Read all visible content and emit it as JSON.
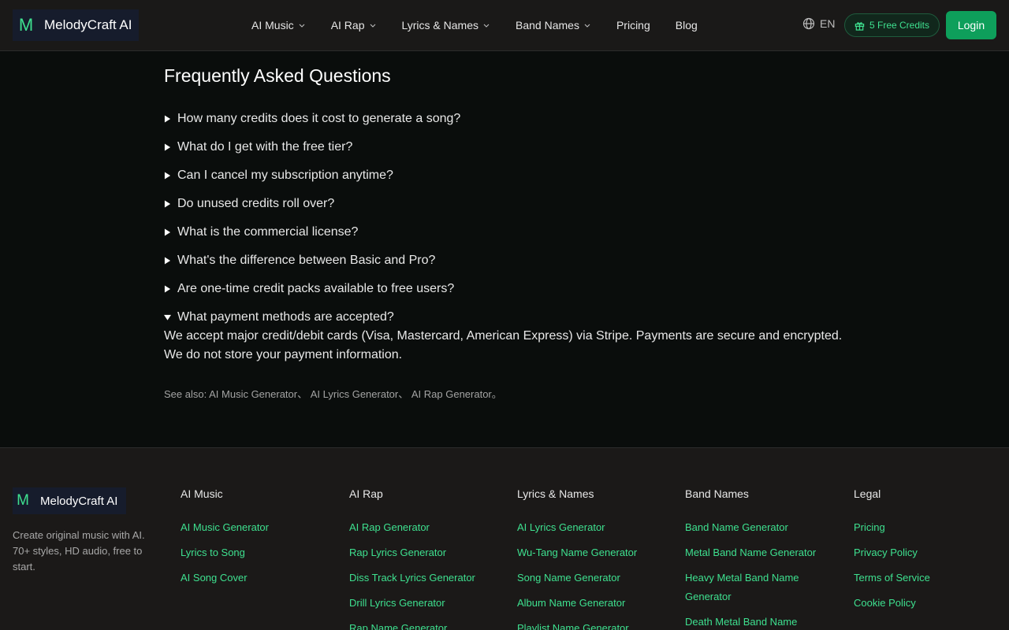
{
  "header": {
    "logo_letter": "M",
    "brand": "MelodyCraft AI",
    "nav": [
      {
        "label": "AI Music",
        "dropdown": true
      },
      {
        "label": "AI Rap",
        "dropdown": true
      },
      {
        "label": "Lyrics & Names",
        "dropdown": true
      },
      {
        "label": "Band Names",
        "dropdown": true
      },
      {
        "label": "Pricing",
        "dropdown": false
      },
      {
        "label": "Blog",
        "dropdown": false
      }
    ],
    "language": "EN",
    "credits": "5 Free Credits",
    "login": "Login"
  },
  "faq": {
    "title": "Frequently Asked Questions",
    "items": [
      {
        "q": "How many credits does it cost to generate a song?",
        "open": false
      },
      {
        "q": "What do I get with the free tier?",
        "open": false
      },
      {
        "q": "Can I cancel my subscription anytime?",
        "open": false
      },
      {
        "q": "Do unused credits roll over?",
        "open": false
      },
      {
        "q": "What is the commercial license?",
        "open": false
      },
      {
        "q": "What's the difference between Basic and Pro?",
        "open": false
      },
      {
        "q": "Are one-time credit packs available to free users?",
        "open": false
      },
      {
        "q": "What payment methods are accepted?",
        "open": true
      }
    ],
    "answer": "We accept major credit/debit cards (Visa, Mastercard, American Express) via Stripe. Payments are secure and encrypted. We do not store your payment information.",
    "see_also_label": "See also: ",
    "see_also_links": [
      "AI Music Generator",
      "AI Lyrics Generator",
      "AI Rap Generator"
    ],
    "separator": "、 ",
    "end_mark": "。"
  },
  "footer": {
    "logo_letter": "M",
    "brand": "MelodyCraft AI",
    "description": "Create original music with AI. 70+ styles, HD audio, free to start.",
    "columns": [
      {
        "title": "AI Music",
        "links": [
          "AI Music Generator",
          "Lyrics to Song",
          "AI Song Cover"
        ]
      },
      {
        "title": "AI Rap",
        "links": [
          "AI Rap Generator",
          "Rap Lyrics Generator",
          "Diss Track Lyrics Generator",
          "Drill Lyrics Generator",
          "Rap Name Generator"
        ]
      },
      {
        "title": "Lyrics & Names",
        "links": [
          "AI Lyrics Generator",
          "Wu-Tang Name Generator",
          "Song Name Generator",
          "Album Name Generator",
          "Playlist Name Generator"
        ]
      },
      {
        "title": "Band Names",
        "links": [
          "Band Name Generator",
          "Metal Band Name Generator",
          "Heavy Metal Band Name Generator",
          "Death Metal Band Name Generator"
        ]
      },
      {
        "title": "Legal",
        "links": [
          "Pricing",
          "Privacy Policy",
          "Terms of Service",
          "Cookie Policy"
        ]
      }
    ]
  },
  "colors": {
    "accent": "#3ee08f",
    "login_bg": "#0e9f5b",
    "header_bg": "#1a1918",
    "page_bg": "#0a0d0c"
  }
}
